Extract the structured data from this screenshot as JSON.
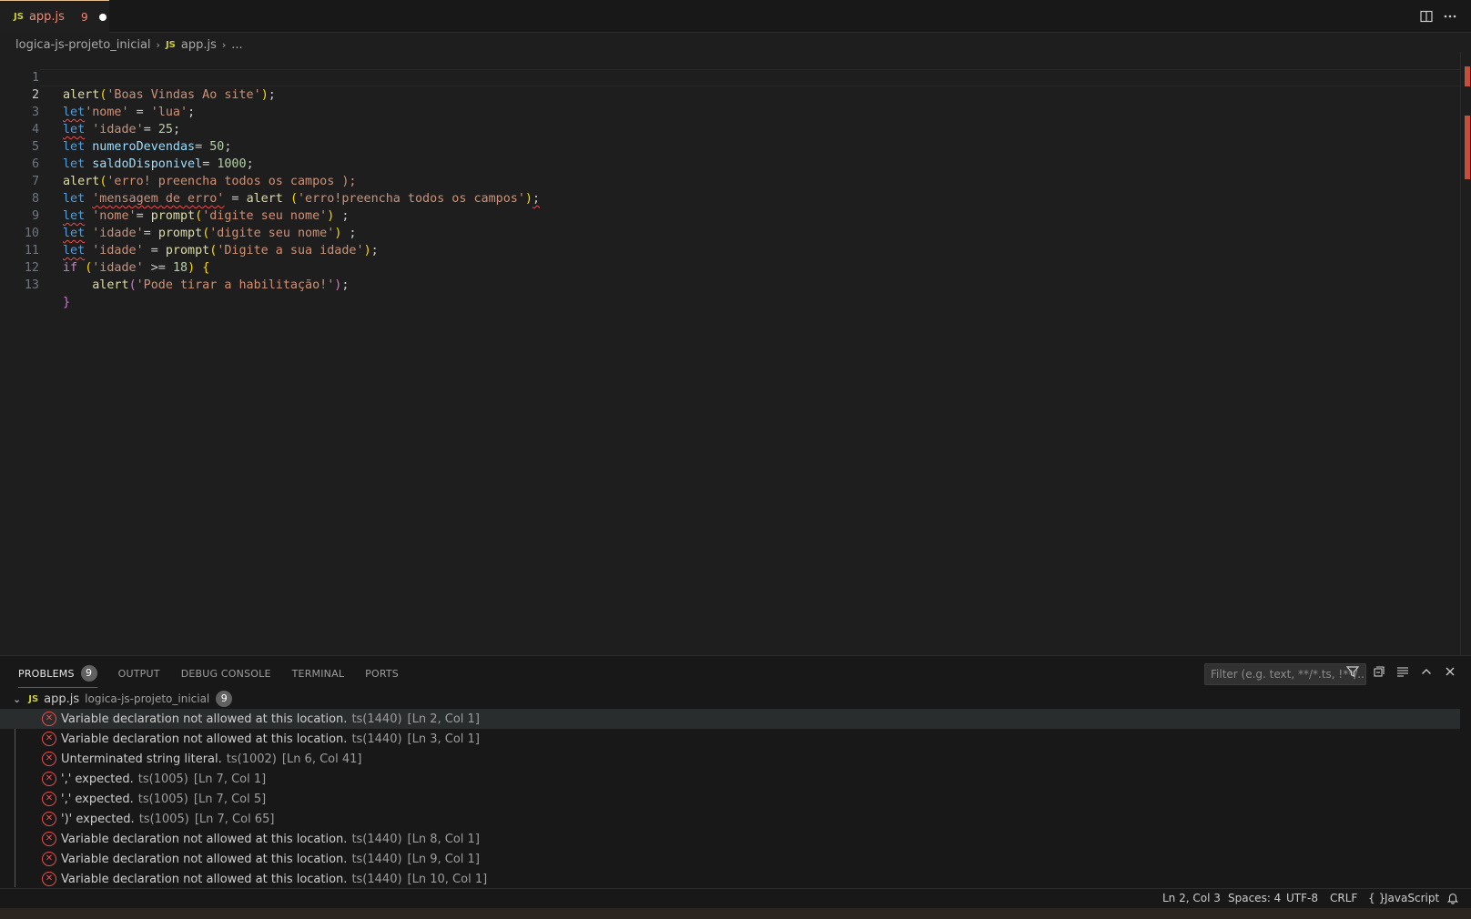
{
  "tab": {
    "icon": "JS",
    "filename": "app.js",
    "problem_count": "9",
    "dirty_indicator": "●"
  },
  "breadcrumb": {
    "folder": "logica-js-projeto_inicial",
    "file_icon": "JS",
    "file": "app.js",
    "more": "..."
  },
  "editor": {
    "active_line": 2,
    "lines": [
      {
        "n": "1"
      },
      {
        "n": "2"
      },
      {
        "n": "3"
      },
      {
        "n": "4"
      },
      {
        "n": "5"
      },
      {
        "n": "6"
      },
      {
        "n": "7"
      },
      {
        "n": "8"
      },
      {
        "n": "9"
      },
      {
        "n": "10"
      },
      {
        "n": "11"
      },
      {
        "n": "12"
      },
      {
        "n": "13"
      }
    ],
    "tokens": {
      "l1": [
        "alert",
        "(",
        "'Boas Vindas Ao site'",
        ")",
        ";"
      ],
      "l2": [
        "let",
        "'nome'",
        " = ",
        "'lua'",
        ";"
      ],
      "l3": [
        "let",
        " ",
        "'idade'",
        "= ",
        "25",
        ";"
      ],
      "l4": [
        "let",
        " ",
        "numeroDevendas",
        "= ",
        "50",
        ";"
      ],
      "l5": [
        "let",
        " ",
        "saldoDisponivel",
        "= ",
        "1000",
        ";"
      ],
      "l6": [
        "alert",
        "(",
        "'erro! preencha todos os campos );"
      ],
      "l7": [
        "let",
        " ",
        "'mensagem de erro'",
        " = ",
        "alert",
        " ",
        "(",
        "'erro!preencha todos os campos'",
        ")",
        ";"
      ],
      "l8": [
        "let",
        " ",
        "'nome'",
        "= ",
        "prompt",
        "(",
        "'digite seu nome'",
        ")",
        " ;"
      ],
      "l9": [
        "let",
        " ",
        "'idade'",
        "= ",
        "prompt",
        "(",
        "'digite seu nome'",
        ")",
        " ;"
      ],
      "l10": [
        "let",
        " ",
        "'idade'",
        " = ",
        "prompt",
        "(",
        "'Digite a sua idade'",
        ")",
        ";"
      ],
      "l11": [
        "if",
        " ",
        "(",
        "'idade'",
        " >= ",
        "18",
        ")",
        " ",
        "{"
      ],
      "l12": [
        "    ",
        "alert",
        "(",
        "'Pode tirar a habilitação!'",
        ")",
        ";"
      ],
      "l13": [
        "}"
      ]
    }
  },
  "panel": {
    "tabs": [
      "PROBLEMS",
      "OUTPUT",
      "DEBUG CONSOLE",
      "TERMINAL",
      "PORTS"
    ],
    "problems_badge": "9",
    "filter_placeholder": "Filter (e.g. text, **/*.ts, !**/...",
    "file_group": {
      "icon": "JS",
      "name": "app.js",
      "path": "logica-js-projeto_inicial",
      "count": "9"
    },
    "problems": [
      {
        "message": "Variable declaration not allowed at this location.",
        "code": "ts(1440)",
        "location": "[Ln 2, Col 1]"
      },
      {
        "message": "Variable declaration not allowed at this location.",
        "code": "ts(1440)",
        "location": "[Ln 3, Col 1]"
      },
      {
        "message": "Unterminated string literal.",
        "code": "ts(1002)",
        "location": "[Ln 6, Col 41]"
      },
      {
        "message": "',' expected.",
        "code": "ts(1005)",
        "location": "[Ln 7, Col 1]"
      },
      {
        "message": "',' expected.",
        "code": "ts(1005)",
        "location": "[Ln 7, Col 5]"
      },
      {
        "message": "')' expected.",
        "code": "ts(1005)",
        "location": "[Ln 7, Col 65]"
      },
      {
        "message": "Variable declaration not allowed at this location.",
        "code": "ts(1440)",
        "location": "[Ln 8, Col 1]"
      },
      {
        "message": "Variable declaration not allowed at this location.",
        "code": "ts(1440)",
        "location": "[Ln 9, Col 1]"
      },
      {
        "message": "Variable declaration not allowed at this location.",
        "code": "ts(1440)",
        "location": "[Ln 10, Col 1]"
      }
    ]
  },
  "statusbar": {
    "position": "Ln 2, Col 3",
    "spaces": "Spaces: 4",
    "encoding": "UTF-8",
    "eol": "CRLF",
    "language_icon": "{ }",
    "language": "JavaScript"
  },
  "colors": {
    "error": "#f14c4c",
    "accent": "#0078d4",
    "js_icon": "#cbcb41"
  }
}
